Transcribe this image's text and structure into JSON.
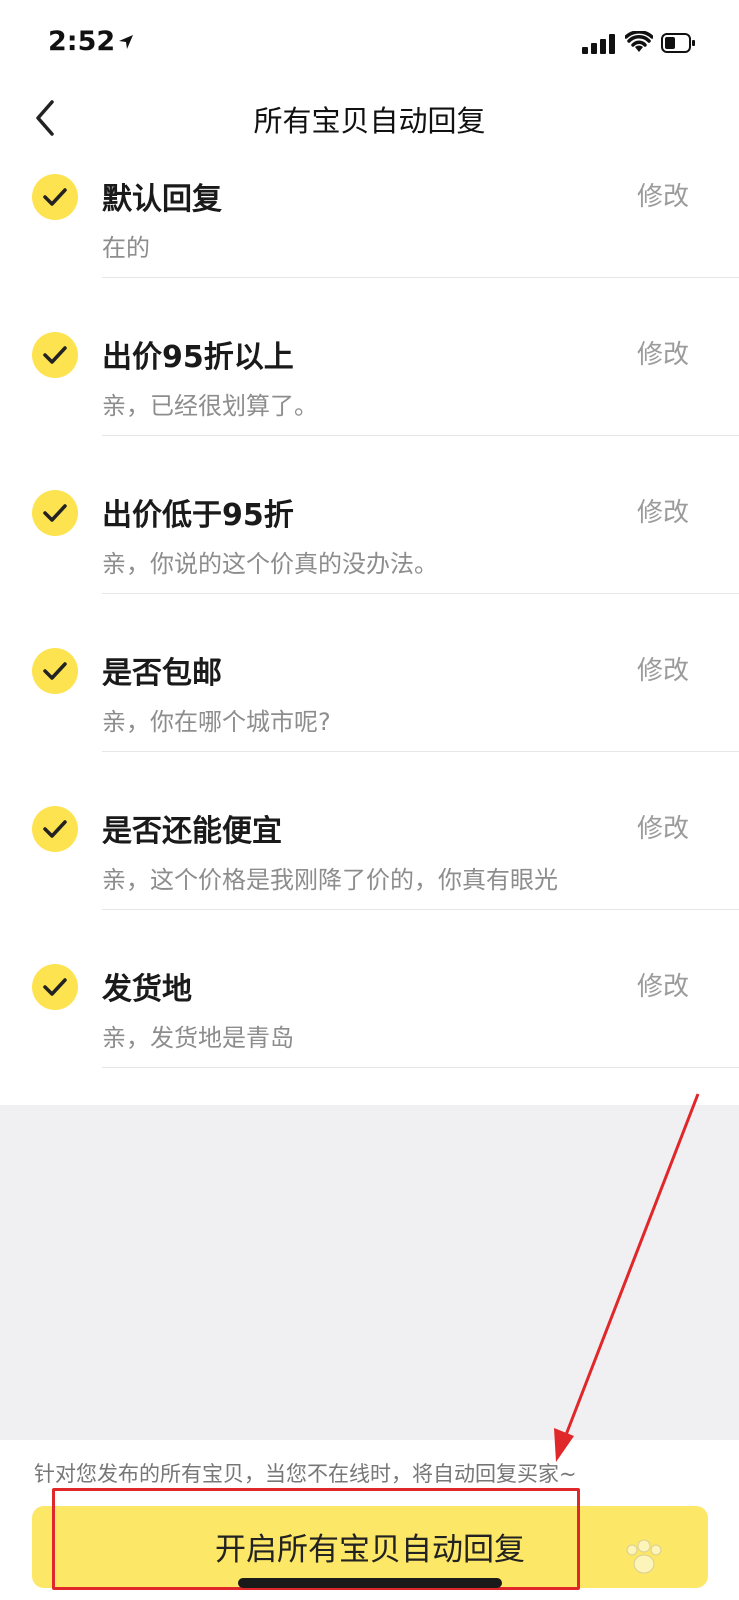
{
  "status_bar": {
    "time": "2:52"
  },
  "nav": {
    "title": "所有宝贝自动回复"
  },
  "replies": [
    {
      "title": "默认回复",
      "text": "在的",
      "edit": "修改",
      "checked": true
    },
    {
      "title": "出价95折以上",
      "text": "亲，已经很划算了。",
      "edit": "修改",
      "checked": true
    },
    {
      "title": "出价低于95折",
      "text": "亲，你说的这个价真的没办法。",
      "edit": "修改",
      "checked": true
    },
    {
      "title": "是否包邮",
      "text": "亲，你在哪个城市呢?",
      "edit": "修改",
      "checked": true
    },
    {
      "title": "是否还能便宜",
      "text": "亲，这个价格是我刚降了价的，你真有眼光",
      "edit": "修改",
      "checked": true
    },
    {
      "title": "发货地",
      "text": "亲，发货地是青岛",
      "edit": "修改",
      "checked": true
    }
  ],
  "footer": {
    "note": "针对您发布的所有宝贝，当您不在线时，将自动回复买家~",
    "button_label": "开启所有宝贝自动回复"
  },
  "colors": {
    "accent": "#fde34f",
    "button": "#fce766",
    "annotation": "#e0282a"
  }
}
